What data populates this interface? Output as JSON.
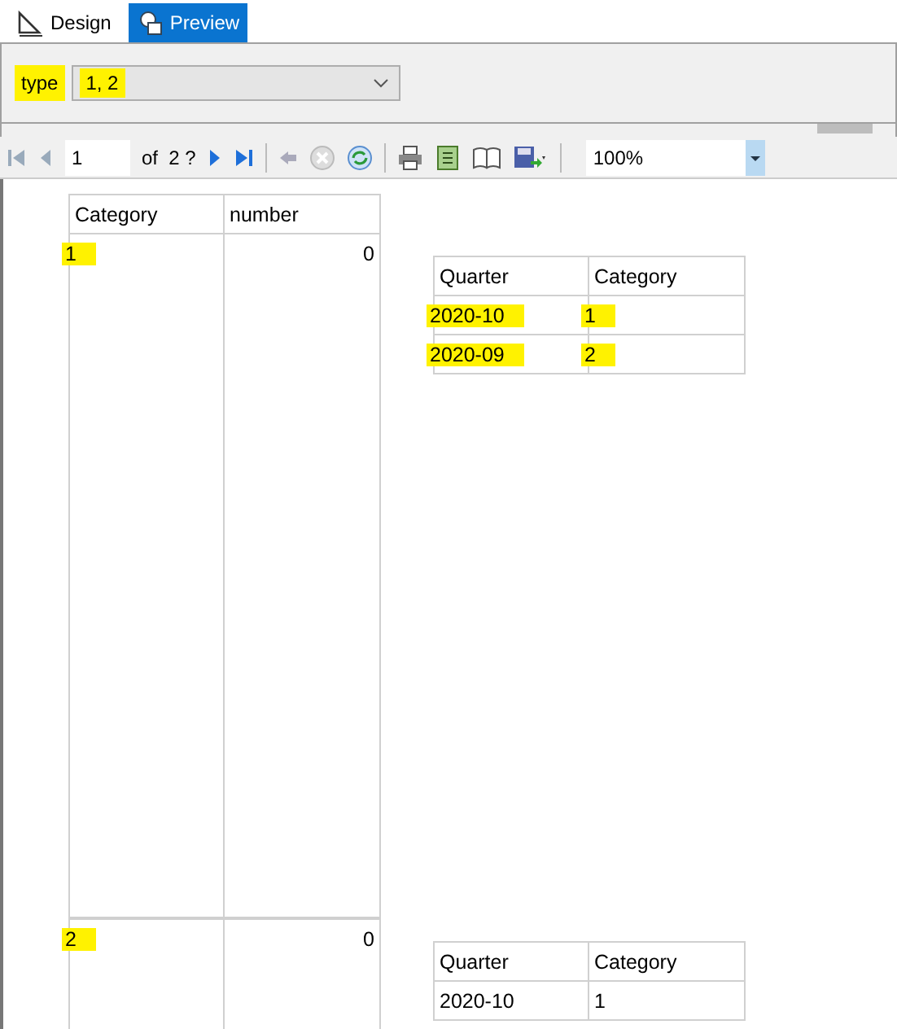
{
  "tabs": [
    {
      "label": "Design",
      "selected": false
    },
    {
      "label": "Preview",
      "selected": true
    }
  ],
  "parameter": {
    "label": "type",
    "value": "1, 2",
    "highlighted": true
  },
  "toolbar": {
    "page": "1",
    "of": "of",
    "total": "2 ?",
    "zoom": "100%"
  },
  "report": {
    "columns": [
      "Category",
      "number"
    ],
    "groups": [
      {
        "category": "1",
        "number": "0",
        "highlighted": true,
        "sub_columns": [
          "Quarter",
          "Category"
        ],
        "rows": [
          {
            "quarter": "2020-10",
            "category": "1",
            "highlighted": true
          },
          {
            "quarter": "2020-09",
            "category": "2",
            "highlighted": true
          }
        ]
      },
      {
        "category": "2",
        "number": "0",
        "highlighted": true,
        "sub_columns": [
          "Quarter",
          "Category"
        ],
        "rows": [
          {
            "quarter": "2020-10",
            "category": "1",
            "highlighted": false
          }
        ]
      }
    ]
  }
}
